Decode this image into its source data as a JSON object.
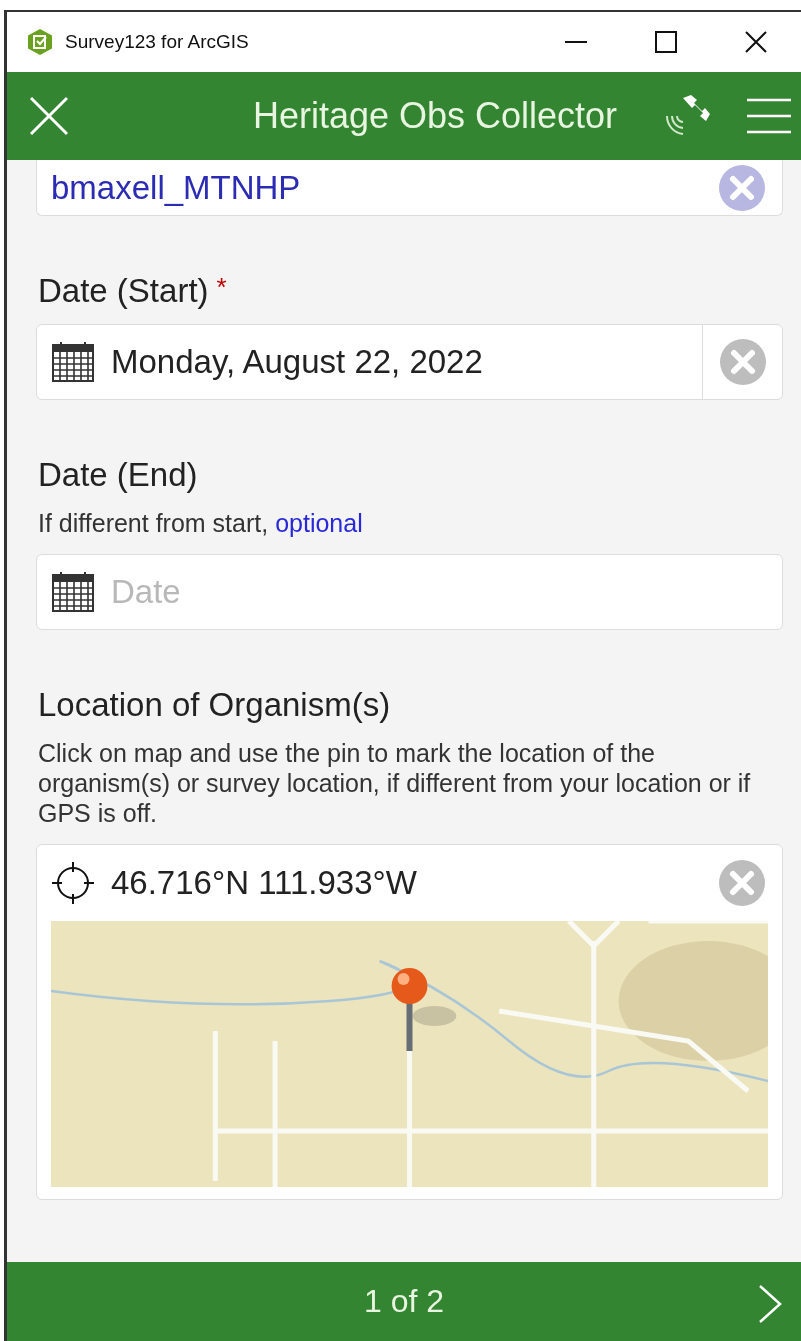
{
  "window": {
    "title": "Survey123 for ArcGIS"
  },
  "header": {
    "title": "Heritage Obs Collector"
  },
  "fields": [
    {
      "kind": "text",
      "value": "bmaxell_MTNHP"
    },
    {
      "kind": "date",
      "label": "Date (Start)",
      "required_mark": "*",
      "value": "Monday, August 22, 2022"
    },
    {
      "kind": "date",
      "label": "Date (End)",
      "hint": "If different from start, ",
      "hint_link": "optional",
      "placeholder": "Date"
    },
    {
      "kind": "geopoint",
      "label": "Location of Organism(s)",
      "hint": "Click on map and use the pin to mark the location of the organism(s) or survey location, if different from your location or if GPS is off.",
      "value": "46.716°N 111.933°W"
    }
  ],
  "footer": {
    "page": "1 of 2"
  }
}
